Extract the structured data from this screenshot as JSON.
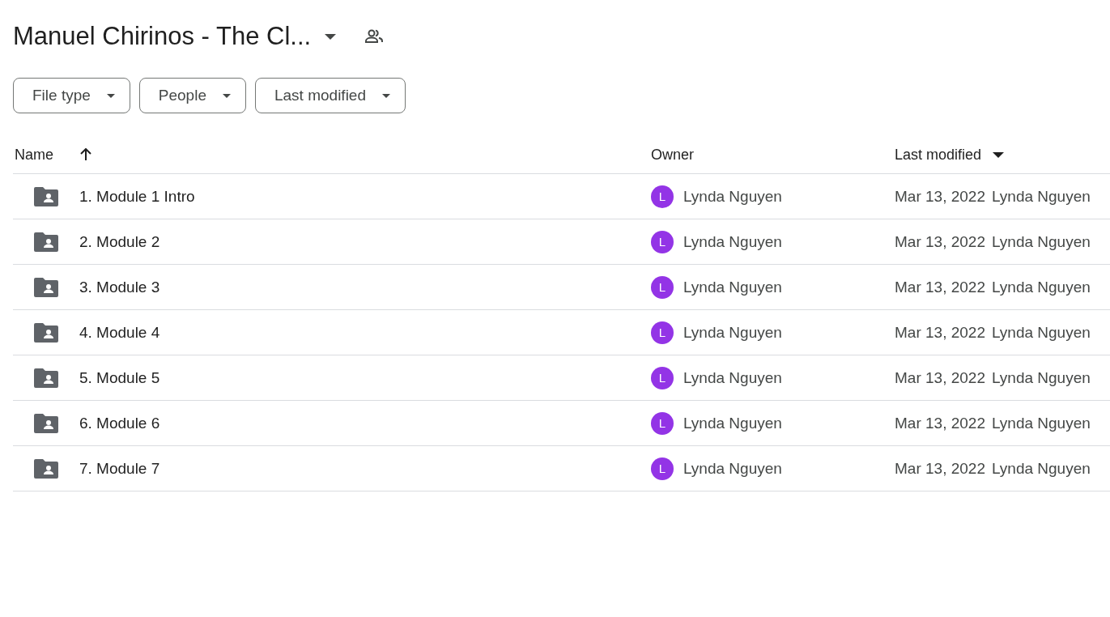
{
  "folder_title": "Manuel Chirinos - The Cl...",
  "filters": [
    {
      "label": "File type"
    },
    {
      "label": "People"
    },
    {
      "label": "Last modified"
    }
  ],
  "table": {
    "columns": [
      "Name",
      "Owner",
      "Last modified"
    ],
    "rows": [
      {
        "name": "1. Module 1 Intro",
        "owner_initial": "L",
        "owner": "Lynda Nguyen",
        "modified_date": "Mar 13, 2022",
        "modified_by": "Lynda Nguyen"
      },
      {
        "name": "2. Module 2",
        "owner_initial": "L",
        "owner": "Lynda Nguyen",
        "modified_date": "Mar 13, 2022",
        "modified_by": "Lynda Nguyen"
      },
      {
        "name": "3. Module 3",
        "owner_initial": "L",
        "owner": "Lynda Nguyen",
        "modified_date": "Mar 13, 2022",
        "modified_by": "Lynda Nguyen"
      },
      {
        "name": "4. Module 4",
        "owner_initial": "L",
        "owner": "Lynda Nguyen",
        "modified_date": "Mar 13, 2022",
        "modified_by": "Lynda Nguyen"
      },
      {
        "name": "5. Module 5",
        "owner_initial": "L",
        "owner": "Lynda Nguyen",
        "modified_date": "Mar 13, 2022",
        "modified_by": "Lynda Nguyen"
      },
      {
        "name": "6. Module 6",
        "owner_initial": "L",
        "owner": "Lynda Nguyen",
        "modified_date": "Mar 13, 2022",
        "modified_by": "Lynda Nguyen"
      },
      {
        "name": "7. Module 7",
        "owner_initial": "L",
        "owner": "Lynda Nguyen",
        "modified_date": "Mar 13, 2022",
        "modified_by": "Lynda Nguyen"
      }
    ]
  }
}
